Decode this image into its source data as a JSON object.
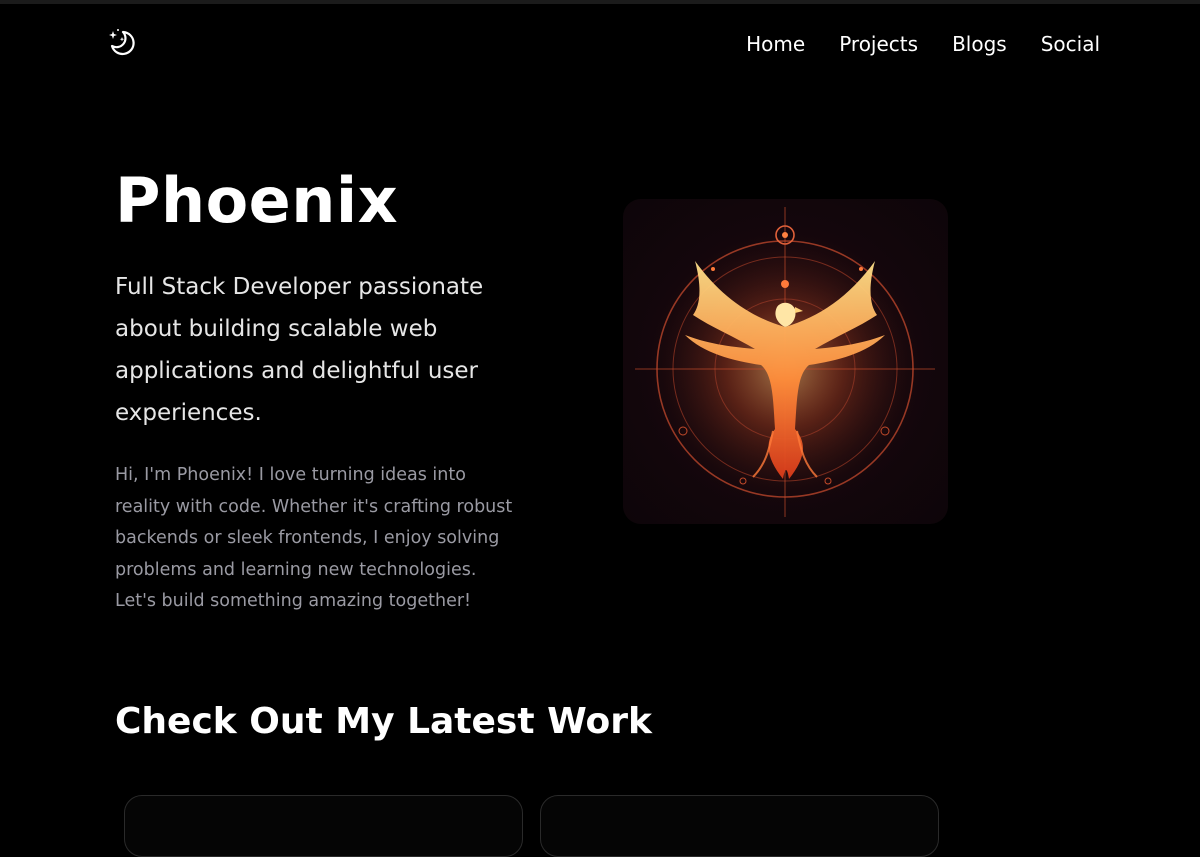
{
  "header": {
    "logo_icon": "moon-stars-icon",
    "nav": [
      {
        "label": "Home"
      },
      {
        "label": "Projects"
      },
      {
        "label": "Blogs"
      },
      {
        "label": "Social"
      }
    ]
  },
  "hero": {
    "name": "Phoenix",
    "tagline": "Full Stack Developer passionate about building scalable web applications and delightful user experiences.",
    "intro": "Hi, I'm Phoenix! I love turning ideas into reality with code. Whether it's crafting robust backends or sleek frontends, I enjoy solving problems and learning new technologies. Let's build something amazing together!",
    "image_icon": "phoenix-emblem-icon"
  },
  "work": {
    "title": "Check Out My Latest Work"
  },
  "colors": {
    "background": "#000000",
    "text": "#ffffff",
    "muted": "#9a9aa3",
    "accent": "#ff8c3a"
  }
}
